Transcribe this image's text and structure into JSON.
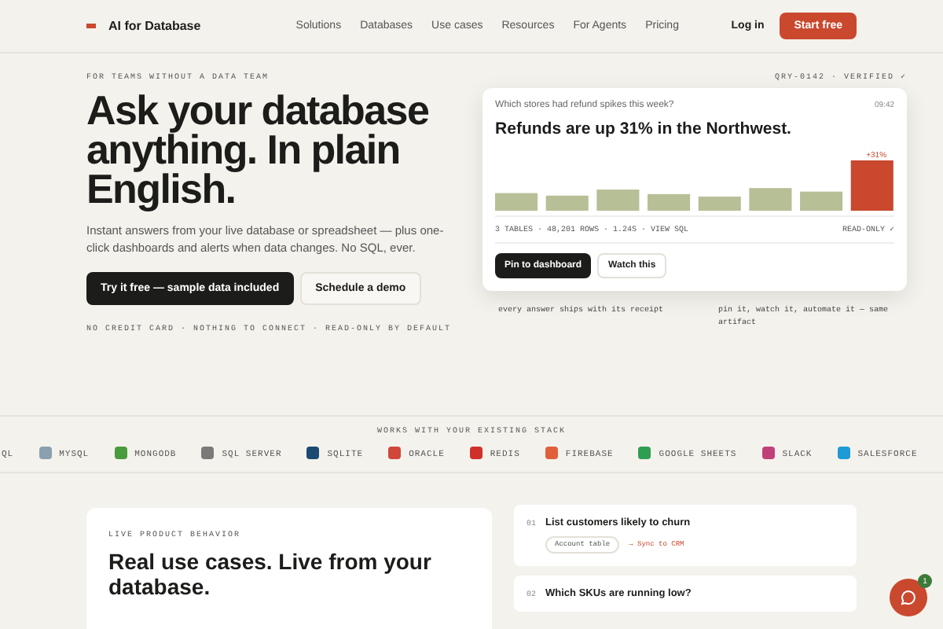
{
  "nav": {
    "brand": "AI for Database",
    "links": [
      "Solutions",
      "Databases",
      "Use cases",
      "Resources",
      "For Agents",
      "Pricing"
    ],
    "login": "Log in",
    "cta": "Start free"
  },
  "hero": {
    "eyebrow": "FOR TEAMS WITHOUT A DATA TEAM",
    "heading": "Ask your database anything. In plain English.",
    "body": "Instant answers from your live database or spreadsheet — plus one-click dashboards and alerts when data changes. No SQL, ever.",
    "primary": "Try it free — sample data included",
    "secondary": "Schedule a demo",
    "note": "NO CREDIT CARD · NOTHING TO CONNECT · READ-ONLY BY DEFAULT"
  },
  "answer_card": {
    "tag": "QRY-0142 · VERIFIED ✓",
    "question": "Which stores had refund spikes this week?",
    "time": "09:42",
    "headline": "Refunds are up 31% in the Northwest.",
    "spike_label": "+31%",
    "meta": "3 TABLES · 48,201 ROWS · 1.24S · VIEW SQL",
    "readonly": "READ-ONLY ✓",
    "actions": [
      "Pin to dashboard",
      "Watch this"
    ],
    "captions": [
      "every answer ships with its receipt",
      "pin it, watch it, automate it — same artifact"
    ]
  },
  "stack": {
    "title": "WORKS WITH YOUR EXISTING STACK",
    "items": [
      {
        "name": "QL"
      },
      {
        "name": "MYSQL",
        "color": "#8aa0b0"
      },
      {
        "name": "MONGODB",
        "color": "#4a9a3e"
      },
      {
        "name": "SQL SERVER",
        "color": "#7a7a7a"
      },
      {
        "name": "SQLITE",
        "color": "#1b4a74"
      },
      {
        "name": "ORACLE",
        "color": "#d0463a"
      },
      {
        "name": "REDIS",
        "color": "#d0302a"
      },
      {
        "name": "FIREBASE",
        "color": "#e0603a"
      },
      {
        "name": "GOOGLE SHEETS",
        "color": "#2f9e52"
      },
      {
        "name": "SLACK",
        "color": "#c0407a"
      },
      {
        "name": "SALESFORCE",
        "color": "#1e9ad6"
      }
    ]
  },
  "showcase": {
    "eyebrow": "LIVE PRODUCT BEHAVIOR",
    "heading": "Real use cases. Live from your database.",
    "cases": [
      {
        "number": "01",
        "title": "List customers likely to churn",
        "source": "Account table",
        "action": "→ Sync to CRM"
      },
      {
        "number": "02",
        "title": "Which SKUs are running low?"
      }
    ]
  },
  "chat": {
    "badge": "1"
  }
}
